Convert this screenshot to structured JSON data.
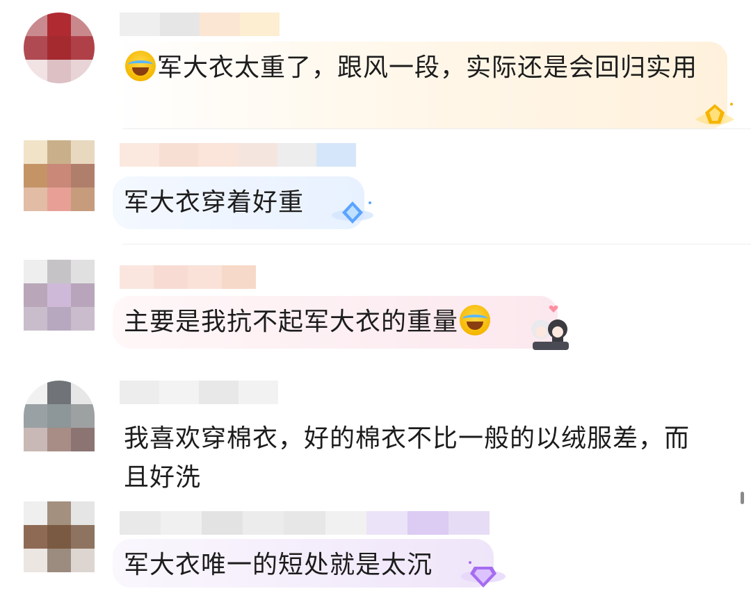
{
  "comments": [
    {
      "text_before": "",
      "text_after": "军大衣太重了，跟风一段，实际还是会回归实用",
      "emoji_before": "laughing-crying-emoji",
      "badge": "gold-crown-badge"
    },
    {
      "text_before": "军大衣穿着好重",
      "text_after": "",
      "badge": "blue-diamond-badge"
    },
    {
      "text_before": "主要是我抗不起军大衣的重量",
      "text_after": "",
      "emoji_after": "laughing-crying-emoji",
      "badge": "anime-couple-sticker"
    },
    {
      "text_before": "我喜欢穿棉衣，好的棉衣不比一般的以绒服差，而且好洗",
      "text_after": ""
    },
    {
      "text_before": "军大衣唯一的短处就是太沉",
      "text_after": "",
      "badge": "purple-gem-badge"
    }
  ],
  "colors": {
    "bubble_gold": "#fff6e6",
    "bubble_blue": "#eaf3ff",
    "bubble_pink": "#fdeef2",
    "bubble_purple": "#f3ecfb",
    "text": "#1c1c1c"
  }
}
